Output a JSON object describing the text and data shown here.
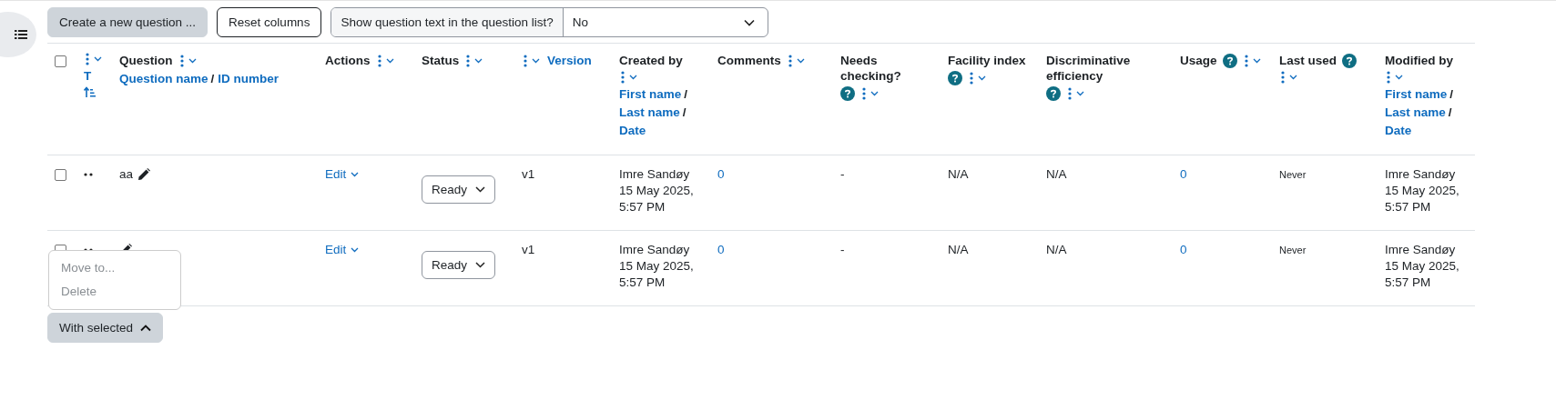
{
  "toolbar": {
    "create_button": "Create a new question ...",
    "reset_button": "Reset columns",
    "show_text": {
      "label": "Show question text in the question list?",
      "value": "No"
    }
  },
  "columns": [
    {
      "kind": "checkbox",
      "checked": false
    },
    {
      "kind": "type",
      "menu": true,
      "links": [
        "T"
      ],
      "sort_ascending": true
    },
    {
      "kind": "column",
      "title": "Question",
      "menu": true,
      "links": [
        "Question name",
        "ID number"
      ]
    },
    {
      "kind": "column",
      "title": "Actions",
      "menu": true
    },
    {
      "kind": "column",
      "title": "Status",
      "menu": true
    },
    {
      "kind": "column",
      "menu": true,
      "links": [
        "Version"
      ]
    },
    {
      "kind": "column",
      "title": "Created by",
      "menu": true,
      "links": [
        "First name",
        "Last name",
        "Date"
      ]
    },
    {
      "kind": "column",
      "title": "Comments",
      "menu": true
    },
    {
      "kind": "column",
      "title": "Needs checking?",
      "menu": true,
      "help": true
    },
    {
      "kind": "column",
      "title": "Facility index",
      "menu": true,
      "help": true
    },
    {
      "kind": "column",
      "title": "Discriminative efficiency",
      "menu": true,
      "help": true
    },
    {
      "kind": "column",
      "title": "Usage",
      "menu": true,
      "help": true
    },
    {
      "kind": "column",
      "title": "Last used",
      "menu": true,
      "help": true
    },
    {
      "kind": "column",
      "title": "Modified by",
      "menu": true,
      "links": [
        "First name",
        "Last name",
        "Date"
      ]
    }
  ],
  "link_separator": "/",
  "rows": [
    {
      "checked": false,
      "name": "aa",
      "action": "Edit",
      "status": "Ready",
      "version": "v1",
      "created_by": "Imre Sandøy",
      "created_date": "15 May 2025, 5:57 PM",
      "comments": "0",
      "needs_checking": "-",
      "facility_index": "N/A",
      "discriminative_efficiency": "N/A",
      "usage": "0",
      "last_used": "Never",
      "modified_by": "Imre Sandøy",
      "modified_date": "15 May 2025, 5:57 PM"
    },
    {
      "checked": false,
      "action": "Edit",
      "status": "Ready",
      "version": "v1",
      "created_by": "Imre Sandøy",
      "created_date": "15 May 2025, 5:57 PM",
      "comments": "0",
      "needs_checking": "-",
      "facility_index": "N/A",
      "discriminative_efficiency": "N/A",
      "usage": "0",
      "last_used": "Never",
      "modified_by": "Imre Sandøy",
      "modified_date": "15 May 2025, 5:57 PM"
    }
  ],
  "bulk": {
    "label": "With selected",
    "expanded": true,
    "items": [
      {
        "label": "Move to...",
        "disabled": true
      },
      {
        "label": "Delete",
        "disabled": true
      }
    ]
  }
}
